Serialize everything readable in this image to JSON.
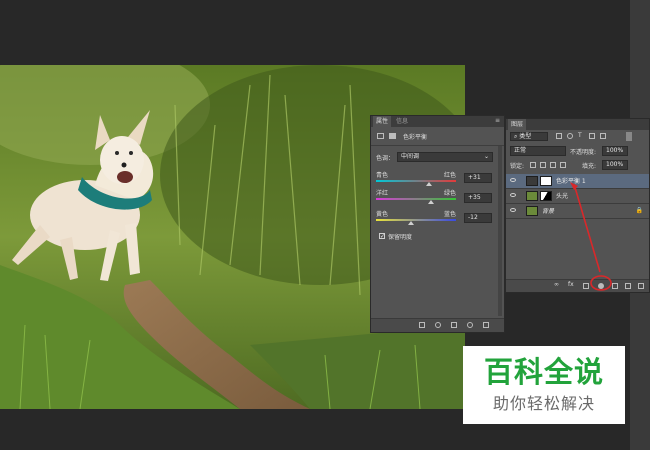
{
  "properties_panel": {
    "tab_properties": "属性",
    "tab_info": "信息",
    "adjustment_title": "色彩平衡",
    "tone_label": "色调：",
    "tone_value": "中间调",
    "sliders": [
      {
        "left": "青色",
        "right": "红色",
        "value": "+31",
        "position": 0.65
      },
      {
        "left": "洋红",
        "right": "绿色",
        "value": "+35",
        "position": 0.68
      },
      {
        "left": "黄色",
        "right": "蓝色",
        "value": "-12",
        "position": 0.44
      }
    ],
    "preserve_luminosity": "保留明度",
    "preserve_checked": true
  },
  "layers_panel": {
    "tab_layers": "图层",
    "filter_kind": "类型",
    "blend_mode": "正常",
    "opacity_label": "不透明度:",
    "opacity_value": "100%",
    "lock_label": "锁定:",
    "fill_label": "填充:",
    "fill_value": "100%",
    "layers": [
      {
        "name": "色彩平衡 1",
        "type": "adjustment",
        "selected": true
      },
      {
        "name": "头光",
        "type": "masked",
        "selected": false
      },
      {
        "name": "背景",
        "type": "background",
        "selected": false
      }
    ]
  },
  "watermark": {
    "title": "百科全说",
    "subtitle": "助你轻松解决"
  },
  "colors": {
    "workspace": "#282828",
    "panel": "#535353",
    "selected_layer": "#5b6a7f",
    "accent_green": "#22a33b",
    "annotation_red": "#d9282a"
  }
}
